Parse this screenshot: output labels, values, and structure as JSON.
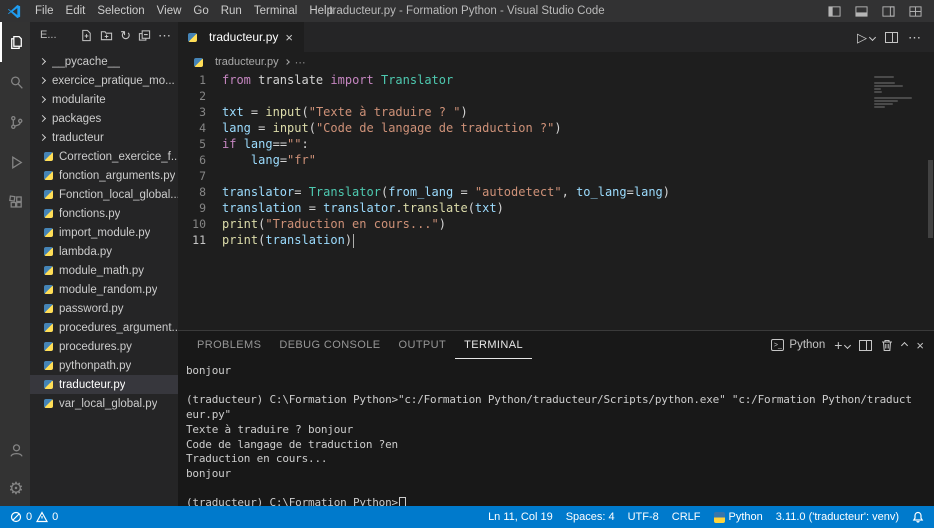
{
  "title_bar": {
    "menus": [
      "File",
      "Edit",
      "Selection",
      "View",
      "Go",
      "Run",
      "Terminal",
      "Help"
    ],
    "title": "traducteur.py - Formation Python - Visual Studio Code"
  },
  "activity_bar": {
    "items": [
      "explorer",
      "search",
      "source-control",
      "run-and-debug",
      "extensions"
    ],
    "bottom": [
      "account",
      "settings"
    ]
  },
  "sidebar": {
    "header_label": "E...",
    "items": [
      {
        "label": "__pycache__",
        "type": "folder"
      },
      {
        "label": "exercice_pratique_mo...",
        "type": "folder"
      },
      {
        "label": "modularite",
        "type": "folder"
      },
      {
        "label": "packages",
        "type": "folder"
      },
      {
        "label": "traducteur",
        "type": "folder"
      },
      {
        "label": "Correction_exercice_f...",
        "type": "file"
      },
      {
        "label": "fonction_arguments.py",
        "type": "file"
      },
      {
        "label": "Fonction_local_global...",
        "type": "file"
      },
      {
        "label": "fonctions.py",
        "type": "file"
      },
      {
        "label": "import_module.py",
        "type": "file"
      },
      {
        "label": "lambda.py",
        "type": "file"
      },
      {
        "label": "module_math.py",
        "type": "file"
      },
      {
        "label": "module_random.py",
        "type": "file"
      },
      {
        "label": "password.py",
        "type": "file"
      },
      {
        "label": "procedures_argument...",
        "type": "file"
      },
      {
        "label": "procedures.py",
        "type": "file"
      },
      {
        "label": "pythonpath.py",
        "type": "file"
      },
      {
        "label": "traducteur.py",
        "type": "file",
        "selected": true
      },
      {
        "label": "var_local_global.py",
        "type": "file"
      }
    ]
  },
  "editor": {
    "tab_label": "traducteur.py",
    "breadcrumb": "traducteur.py",
    "active_line": 11,
    "lines": [
      {
        "num": 1,
        "tokens": [
          {
            "t": "from",
            "c": "k"
          },
          {
            "t": " translate ",
            "c": "p"
          },
          {
            "t": "import",
            "c": "k"
          },
          {
            "t": " ",
            "c": "p"
          },
          {
            "t": "Translator",
            "c": "t"
          }
        ]
      },
      {
        "num": 2,
        "tokens": []
      },
      {
        "num": 3,
        "tokens": [
          {
            "t": "txt",
            "c": "v"
          },
          {
            "t": " = ",
            "c": "p"
          },
          {
            "t": "input",
            "c": "f"
          },
          {
            "t": "(",
            "c": "p"
          },
          {
            "t": "\"Texte à traduire ? \"",
            "c": "s"
          },
          {
            "t": ")",
            "c": "p"
          }
        ]
      },
      {
        "num": 4,
        "tokens": [
          {
            "t": "lang",
            "c": "v"
          },
          {
            "t": " = ",
            "c": "p"
          },
          {
            "t": "input",
            "c": "f"
          },
          {
            "t": "(",
            "c": "p"
          },
          {
            "t": "\"Code de langage de traduction ?\"",
            "c": "s"
          },
          {
            "t": ")",
            "c": "p"
          }
        ]
      },
      {
        "num": 5,
        "tokens": [
          {
            "t": "if",
            "c": "k"
          },
          {
            "t": " ",
            "c": "p"
          },
          {
            "t": "lang",
            "c": "v"
          },
          {
            "t": "==",
            "c": "p"
          },
          {
            "t": "\"\"",
            "c": "s"
          },
          {
            "t": ":",
            "c": "p"
          }
        ]
      },
      {
        "num": 6,
        "tokens": [
          {
            "t": "    ",
            "c": "p"
          },
          {
            "t": "lang",
            "c": "v"
          },
          {
            "t": "=",
            "c": "p"
          },
          {
            "t": "\"fr\"",
            "c": "s"
          }
        ]
      },
      {
        "num": 7,
        "tokens": []
      },
      {
        "num": 8,
        "tokens": [
          {
            "t": "translator",
            "c": "v"
          },
          {
            "t": "= ",
            "c": "p"
          },
          {
            "t": "Translator",
            "c": "t"
          },
          {
            "t": "(",
            "c": "p"
          },
          {
            "t": "from_lang",
            "c": "v"
          },
          {
            "t": " = ",
            "c": "p"
          },
          {
            "t": "\"autodetect\"",
            "c": "s"
          },
          {
            "t": ", ",
            "c": "p"
          },
          {
            "t": "to_lang",
            "c": "v"
          },
          {
            "t": "=",
            "c": "p"
          },
          {
            "t": "lang",
            "c": "v"
          },
          {
            "t": ")",
            "c": "p"
          }
        ]
      },
      {
        "num": 9,
        "tokens": [
          {
            "t": "translation",
            "c": "v"
          },
          {
            "t": " = ",
            "c": "p"
          },
          {
            "t": "translator",
            "c": "v"
          },
          {
            "t": ".",
            "c": "p"
          },
          {
            "t": "translate",
            "c": "f"
          },
          {
            "t": "(",
            "c": "p"
          },
          {
            "t": "txt",
            "c": "v"
          },
          {
            "t": ")",
            "c": "p"
          }
        ]
      },
      {
        "num": 10,
        "tokens": [
          {
            "t": "print",
            "c": "f"
          },
          {
            "t": "(",
            "c": "p"
          },
          {
            "t": "\"Traduction en cours...\"",
            "c": "s"
          },
          {
            "t": ")",
            "c": "p"
          }
        ]
      },
      {
        "num": 11,
        "cursor": true,
        "tokens": [
          {
            "t": "print",
            "c": "f"
          },
          {
            "t": "(",
            "c": "p"
          },
          {
            "t": "translation",
            "c": "v"
          },
          {
            "t": ")",
            "c": "p"
          }
        ]
      }
    ]
  },
  "panel": {
    "tabs": [
      {
        "label": "PROBLEMS"
      },
      {
        "label": "DEBUG CONSOLE"
      },
      {
        "label": "OUTPUT"
      },
      {
        "label": "TERMINAL",
        "active": true
      }
    ],
    "shell_label": "Python",
    "terminal_lines": [
      "bonjour",
      "",
      "(traducteur) C:\\Formation Python>\"c:/Formation Python/traducteur/Scripts/python.exe\" \"c:/Formation Python/traduct",
      "eur.py\"",
      "Texte à traduire ? bonjour",
      "Code de langage de traduction ?en",
      "Traduction en cours...",
      "bonjour",
      "",
      "(traducteur) C:\\Formation Python>"
    ]
  },
  "status_bar": {
    "errors": "0",
    "warnings": "0",
    "line_col": "Ln 11, Col 19",
    "spaces": "Spaces: 4",
    "encoding": "UTF-8",
    "eol": "CRLF",
    "language": "Python",
    "interpreter": "3.11.0 ('traducteur': venv)"
  },
  "icons": {
    "close": "×",
    "more": "⋯",
    "plus": "+",
    "run": "▷",
    "refresh": "↻",
    "gear": "⚙"
  }
}
